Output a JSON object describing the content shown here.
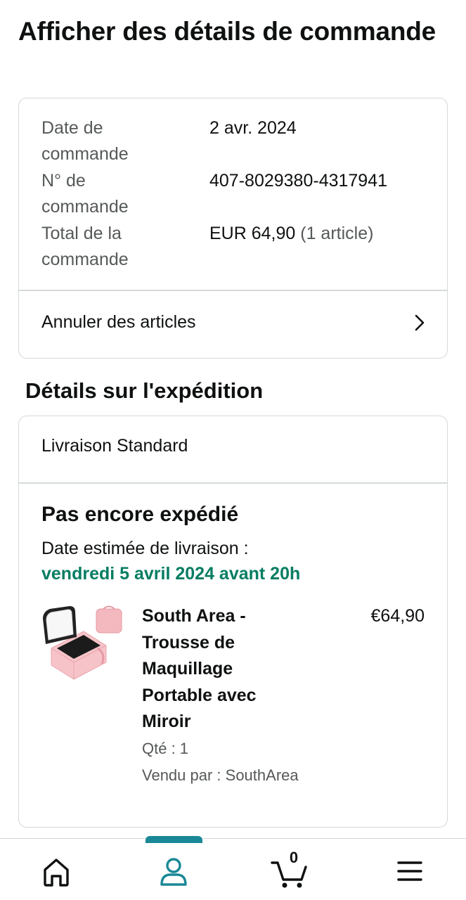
{
  "page": {
    "title": "Afficher des détails de commande"
  },
  "order_summary": {
    "rows": [
      {
        "label": "Date de commande",
        "value": "2 avr. 2024",
        "extra": ""
      },
      {
        "label": "N° de commande",
        "value": "407-8029380-4317941",
        "extra": ""
      },
      {
        "label": "Total de la commande",
        "value": "EUR 64,90",
        "extra": "(1 article)"
      }
    ],
    "action": {
      "label": "Annuler des articles",
      "icon": "chevron-right-icon"
    }
  },
  "shipping": {
    "section_title": "Détails sur l'expédition",
    "method": "Livraison Standard",
    "status": "Pas encore expédié",
    "eta_label": "Date estimée de livraison :",
    "eta_date": "vendredi 5 avril 2024 avant 20h",
    "eta_color": "#067d62",
    "item": {
      "title": "South Area - Trousse de Maquillage Portable avec Miroir",
      "price": "€64,90",
      "quantity": "Qté : 1",
      "seller": "Vendu par : SouthArea",
      "image_icon": "makeup-case-image"
    }
  },
  "bottom_nav": {
    "items": [
      {
        "name": "home",
        "icon": "home-icon",
        "active": false
      },
      {
        "name": "account",
        "icon": "account-icon",
        "active": true
      },
      {
        "name": "cart",
        "icon": "cart-icon",
        "active": false,
        "count": "0"
      },
      {
        "name": "menu",
        "icon": "menu-icon",
        "active": false
      }
    ],
    "active_color": "#1a8896"
  }
}
